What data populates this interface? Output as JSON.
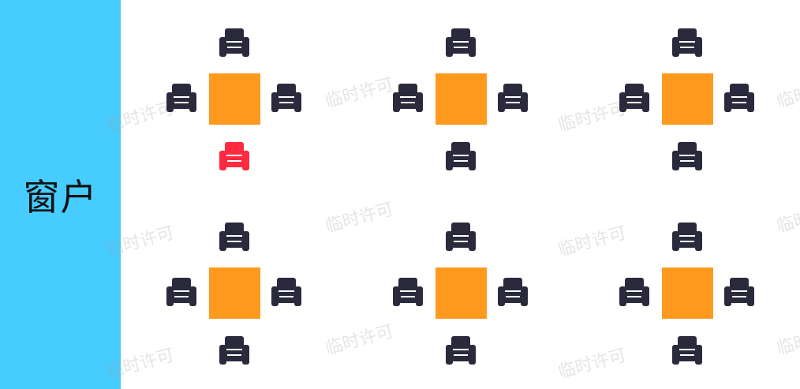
{
  "window_label": "窗户",
  "watermark_text": "临时许可",
  "colors": {
    "window_panel": "#46ccff",
    "table": "#ff9a1e",
    "seat_available": "#2a2a3c",
    "seat_selected": "#ff2a3f"
  },
  "seat_icon": "armchair-icon",
  "tables": [
    {
      "id": "table-1",
      "seats": [
        {
          "side": "top",
          "status": "available"
        },
        {
          "side": "left",
          "status": "available"
        },
        {
          "side": "right",
          "status": "available"
        },
        {
          "side": "bottom",
          "status": "selected"
        }
      ]
    },
    {
      "id": "table-2",
      "seats": [
        {
          "side": "top",
          "status": "available"
        },
        {
          "side": "left",
          "status": "available"
        },
        {
          "side": "right",
          "status": "available"
        },
        {
          "side": "bottom",
          "status": "available"
        }
      ]
    },
    {
      "id": "table-3",
      "seats": [
        {
          "side": "top",
          "status": "available"
        },
        {
          "side": "left",
          "status": "available"
        },
        {
          "side": "right",
          "status": "available"
        },
        {
          "side": "bottom",
          "status": "available"
        }
      ]
    },
    {
      "id": "table-4",
      "seats": [
        {
          "side": "top",
          "status": "available"
        },
        {
          "side": "left",
          "status": "available"
        },
        {
          "side": "right",
          "status": "available"
        },
        {
          "side": "bottom",
          "status": "available"
        }
      ]
    },
    {
      "id": "table-5",
      "seats": [
        {
          "side": "top",
          "status": "available"
        },
        {
          "side": "left",
          "status": "available"
        },
        {
          "side": "right",
          "status": "available"
        },
        {
          "side": "bottom",
          "status": "available"
        }
      ]
    },
    {
      "id": "table-6",
      "seats": [
        {
          "side": "top",
          "status": "available"
        },
        {
          "side": "left",
          "status": "available"
        },
        {
          "side": "right",
          "status": "available"
        },
        {
          "side": "bottom",
          "status": "available"
        }
      ]
    }
  ]
}
